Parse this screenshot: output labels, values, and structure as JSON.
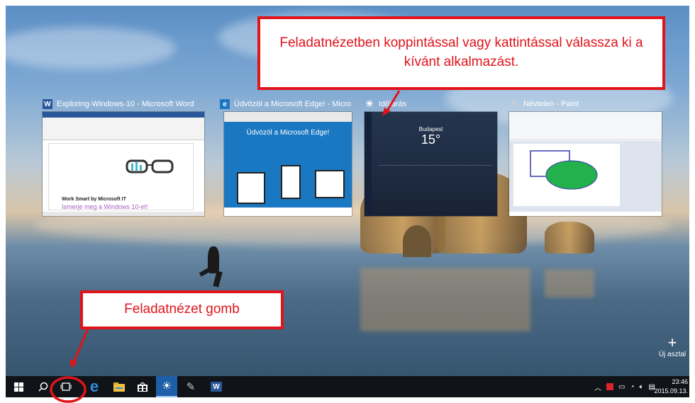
{
  "callouts": {
    "top": "Feladatnézetben koppintással vagy kattintással válassza ki a kívánt alkalmazást.",
    "bottom": "Feladatnézet gomb"
  },
  "windows": [
    {
      "title": "Exploring-Windows-10 - Microsoft Word",
      "icon": "word-icon",
      "content_line1": "Work Smart by Microsoft IT",
      "content_line2": "Ismerje meg a Windows 10-et!"
    },
    {
      "title": "Üdvözöl a Microsoft Edge! - Microsof...",
      "icon": "edge-icon",
      "heading": "Üdvözöl a Microsoft Edge!"
    },
    {
      "title": "Időjárás",
      "icon": "weather-icon",
      "city": "Budapest",
      "temp": "15°"
    },
    {
      "title": "Névtelen - Paint",
      "icon": "paint-icon"
    }
  ],
  "new_desktop": {
    "plus": "+",
    "label": "Új asztal"
  },
  "taskbar": {
    "clock_time": "23:46",
    "clock_date": "2015.09.13.",
    "pinned": [
      "windows-start-icon",
      "search-icon",
      "task-view-icon",
      "edge-icon",
      "file-explorer-icon",
      "store-icon",
      "weather-icon",
      "paint-icon",
      "word-icon"
    ]
  },
  "colors": {
    "accent_red": "#e0141b",
    "taskbar": "#101418",
    "word_blue": "#2b579a",
    "edge_blue": "#1a78c2"
  }
}
